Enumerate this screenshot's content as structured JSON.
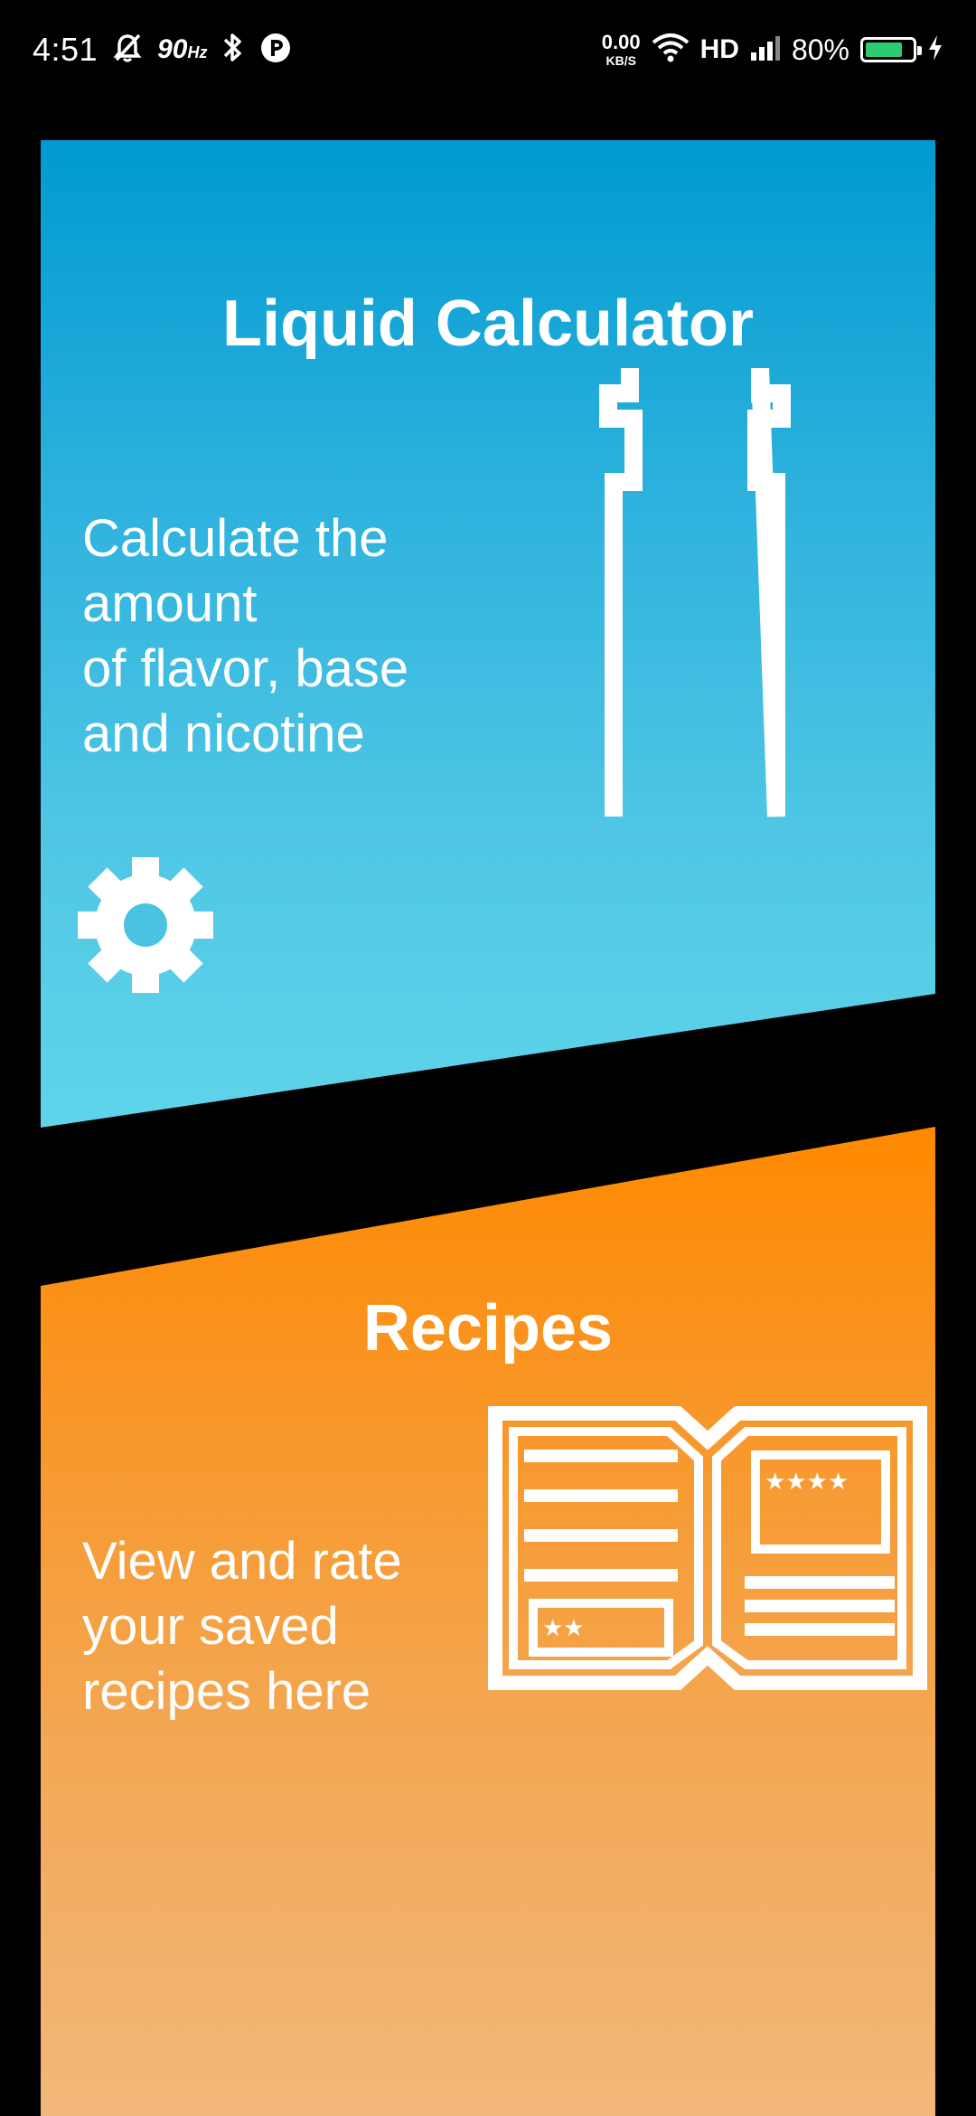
{
  "status_bar": {
    "time": "4:51",
    "refresh_rate": "90",
    "refresh_rate_unit": "Hz",
    "net_speed_value": "0.00",
    "net_speed_unit": "KB/S",
    "network_type": "HD",
    "battery_percent_text": "80%",
    "battery_level": 0.8,
    "battery_color": "#2ecc71",
    "icons": [
      "bell-off-icon",
      "bluetooth-icon",
      "app-status-icon",
      "wifi-icon",
      "signal-icon",
      "battery-icon",
      "charging-icon"
    ]
  },
  "calculator_card": {
    "title": "Liquid Calculator",
    "description": "Calculate the\namount\nof flavor, base\nand nicotine",
    "icon": "bottle-icon",
    "settings_icon": "gear-icon",
    "gradient": [
      "#009ad0",
      "#5fd4ea"
    ]
  },
  "recipes_card": {
    "title": "Recipes",
    "description": "View and rate\nyour saved\nrecipes here",
    "icon": "recipe-book-icon",
    "gradient": [
      "#ff8900",
      "#f2b77a"
    ]
  }
}
